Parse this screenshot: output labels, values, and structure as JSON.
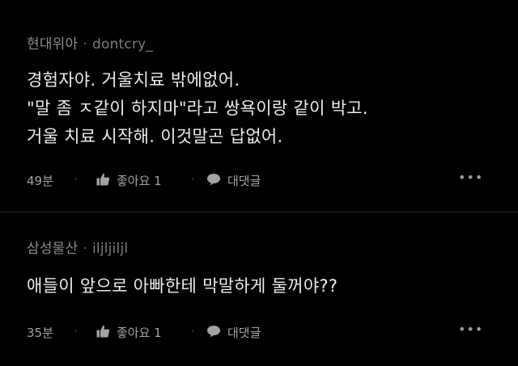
{
  "comments": [
    {
      "author": "현대위아",
      "separator": "·",
      "nickname": "dontcry_",
      "lines": [
        "경험자야. 거울치료 밖에없어.",
        "\"말 좀 ㅈ같이 하지마\"라고 쌍욕이랑 같이 박고.",
        "거울 치료 시작해. 이것말곤 답없어."
      ],
      "time": "49분",
      "like_label": "좋아요 1",
      "reply_label": "대댓글",
      "more_label": "•••"
    },
    {
      "author": "삼성물산",
      "separator": "·",
      "nickname": "iljljiljl",
      "lines": [
        "애들이 앞으로 아빠한테 막말하게 둘꺼야??"
      ],
      "time": "35분",
      "like_label": "좋아요 1",
      "reply_label": "대댓글",
      "more_label": "•••"
    }
  ],
  "colors": {
    "background": "#000000",
    "text": "#ececec",
    "meta": "#8d8d8d",
    "divider": "#2a2a2a"
  },
  "icons": [
    "thumbs-up-icon",
    "speech-bubble-icon",
    "more-dots-icon"
  ]
}
